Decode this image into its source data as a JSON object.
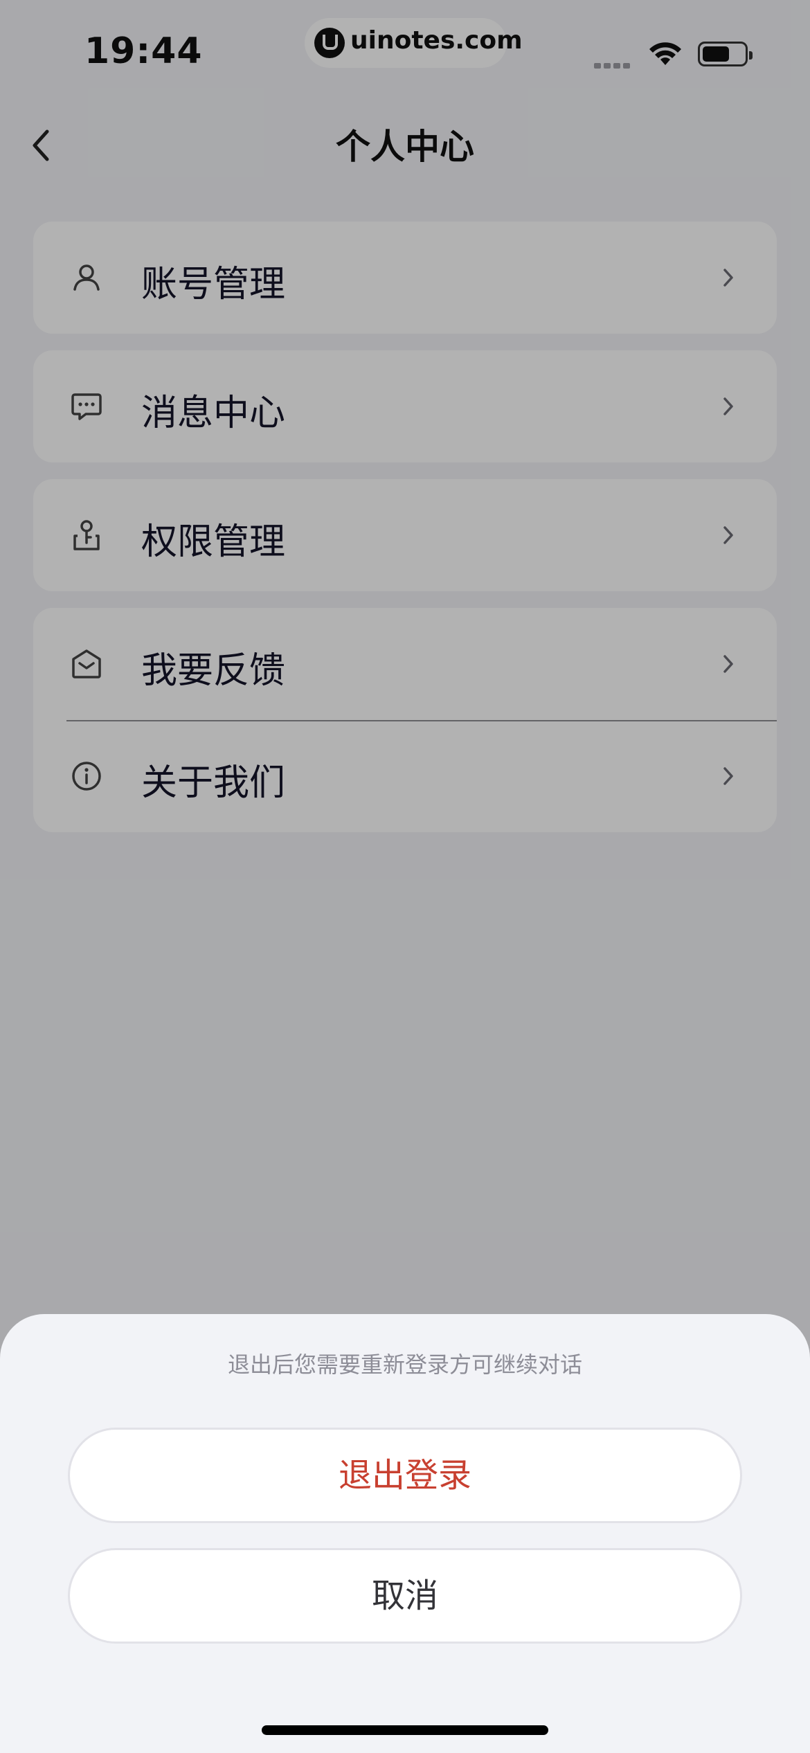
{
  "status_bar": {
    "time": "19:44",
    "watermark_url": "uinotes.com"
  },
  "nav": {
    "title": "个人中心",
    "back_icon": "chevron-left-icon"
  },
  "menu_groups": [
    {
      "items": [
        {
          "icon": "user-icon",
          "label": "账号管理"
        }
      ]
    },
    {
      "items": [
        {
          "icon": "message-icon",
          "label": "消息中心"
        }
      ]
    },
    {
      "items": [
        {
          "icon": "permission-icon",
          "label": "权限管理"
        }
      ]
    },
    {
      "items": [
        {
          "icon": "feedback-mail-icon",
          "label": "我要反馈"
        },
        {
          "icon": "info-icon",
          "label": "关于我们"
        }
      ]
    }
  ],
  "logout_sheet": {
    "tip": "退出后您需要重新登录方可继续对话",
    "confirm_label": "退出登录",
    "cancel_label": "取消"
  },
  "colors": {
    "background": "#f2f3f7",
    "card": "#ffffff",
    "danger": "#c84030",
    "overlay": "rgba(0,0,0,0.30)"
  }
}
